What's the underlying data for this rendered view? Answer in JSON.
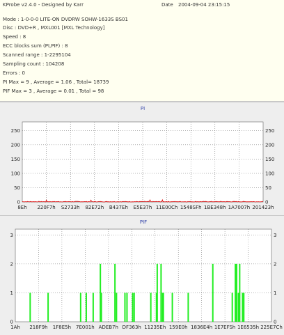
{
  "header": {
    "app_title": "KProbe v2.4.0 - Designed by Karr",
    "date_label": "Date",
    "date_value": "2004-09-04 23:15:15",
    "lines": [
      "Mode : 1-0-0-0 LITE-ON DVDRW SOHW-1633S BS01",
      "Disc : DVD+R , MXL001 [MXL Technology]",
      "Speed : 8",
      "ECC blocks sum (PI,PIF) : 8",
      "Scanned range : 1-2295104",
      "Sampling count : 104208",
      "Errors : 0",
      "PI Max = 9 , Average = 1.06 , Total= 18739",
      "PIF Max = 3 , Average = 0.01 , Total = 98"
    ]
  },
  "chart_data": [
    {
      "type": "line",
      "title": "PI",
      "ylim": [
        0,
        280
      ],
      "yticks": [
        0,
        50,
        100,
        150,
        200,
        250
      ],
      "xtick_labels": [
        "8Eh",
        "220F7h",
        "S2733h",
        "82E72h",
        "B437Eh",
        "E5E37h",
        "11E00Ch",
        "1548SFh",
        "1BE348h",
        "1A7007h",
        "201423h"
      ],
      "series": [
        {
          "color": "#dd0000",
          "baseline": 1.06,
          "max": 9
        }
      ],
      "grid": true
    },
    {
      "type": "bar",
      "title": "PIF",
      "ylim": [
        0,
        3.2
      ],
      "yticks": [
        0,
        1,
        2,
        3
      ],
      "xtick_labels": [
        "1Ah",
        "218F9h",
        "1F8E5h",
        "7E001h",
        "ADEB7h",
        "DF363h",
        "11235Eh",
        "159E0h",
        "1836E4h",
        "1E7EFSh",
        "1E6535h",
        "225E7Ch"
      ],
      "series": [
        {
          "color": "#22ee22"
        }
      ],
      "x": [
        0.058,
        0.128,
        0.255,
        0.277,
        0.304,
        0.332,
        0.336,
        0.389,
        0.395,
        0.428,
        0.436,
        0.458,
        0.464,
        0.529,
        0.551,
        0.554,
        0.569,
        0.575,
        0.578,
        0.613,
        0.675,
        0.771,
        0.847,
        0.859,
        0.864,
        0.871,
        0.876,
        0.887,
        0.892
      ],
      "values": [
        1,
        1,
        1,
        1,
        1,
        2,
        1,
        2,
        1,
        1,
        1,
        1,
        1,
        1,
        1,
        2,
        2,
        1,
        1,
        1,
        1,
        2,
        1,
        2,
        2,
        1,
        2,
        1,
        1
      ],
      "grid": true
    }
  ]
}
